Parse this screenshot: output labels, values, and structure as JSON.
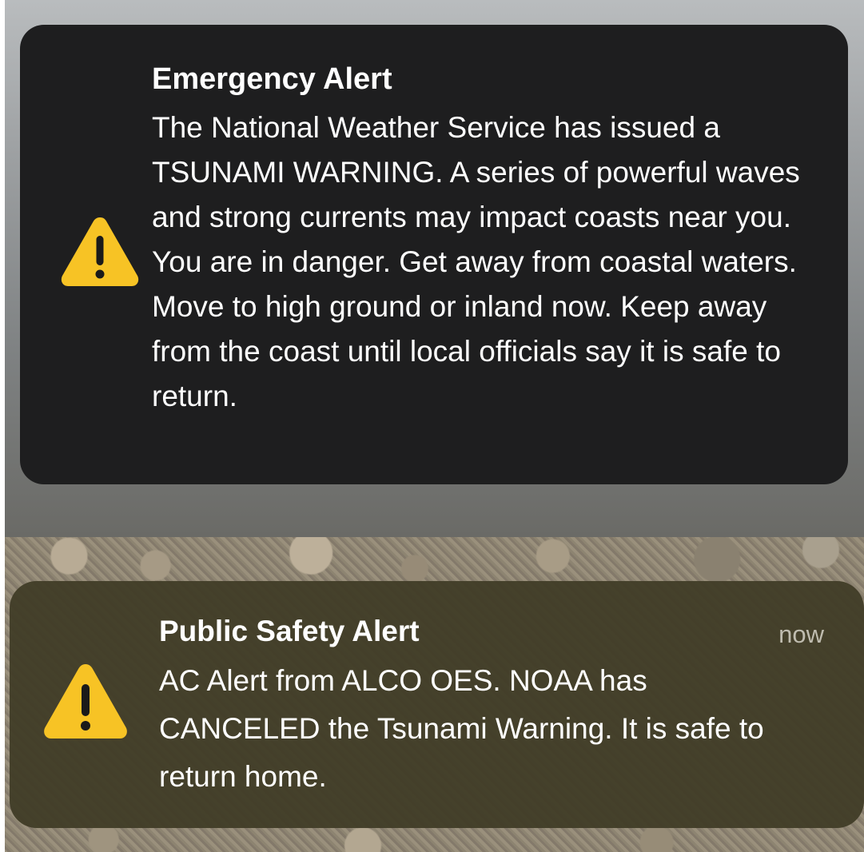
{
  "alerts": [
    {
      "title": "Emergency Alert",
      "icon": "warning-triangle-icon",
      "body": "The National Weather Service has issued a TSUNAMI WARNING. A series of powerful waves and strong currents may impact coasts near you. You are in danger. Get away from coastal waters. Move to high ground or inland now. Keep away from the coast until local officials say it is safe to return."
    },
    {
      "title": "Public Safety Alert",
      "time": "now",
      "icon": "warning-triangle-icon",
      "body": "AC Alert from ALCO OES. NOAA has CANCELED the Tsunami Warning. It is safe to return home."
    }
  ],
  "colors": {
    "warning_yellow": "#f7c325",
    "emergency_card": "#1e1e1f",
    "public_card": "#403c26",
    "timestamp": "#bfbcaf"
  }
}
